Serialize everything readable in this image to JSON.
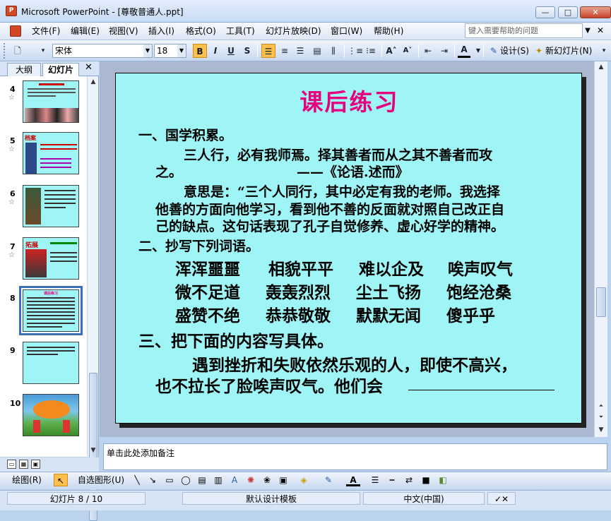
{
  "window": {
    "title": "Microsoft PowerPoint - [尊敬普通人.ppt]",
    "app_icon": "P"
  },
  "window_controls": {
    "min": "—",
    "max": "□",
    "close": "✕"
  },
  "menu": [
    "文件(F)",
    "编辑(E)",
    "视图(V)",
    "插入(I)",
    "格式(O)",
    "工具(T)",
    "幻灯片放映(D)",
    "窗口(W)",
    "帮助(H)"
  ],
  "help_placeholder": "键入需要帮助的问题",
  "toolbar": {
    "font": "宋体",
    "size": "18",
    "bold": "B",
    "italic": "I",
    "underline": "U",
    "shadow": "S",
    "font_color": "A",
    "design": "设计(S)",
    "new_slide": "新幻灯片(N)"
  },
  "pane_tabs": {
    "outline": "大纲",
    "slides": "幻灯片"
  },
  "thumbnails": [
    {
      "num": "4",
      "star": "☆"
    },
    {
      "num": "5",
      "star": "☆",
      "title": "档案"
    },
    {
      "num": "6",
      "star": "☆"
    },
    {
      "num": "7",
      "star": "☆",
      "title": "拓展"
    },
    {
      "num": "8",
      "title": "课后练习"
    },
    {
      "num": "9"
    },
    {
      "num": "10"
    }
  ],
  "slide": {
    "title": "课后练习",
    "lines": [
      "一、国学积累。",
      "三人行，必有我师焉。择其善者而从之其不善者而攻",
      "之。",
      "——《论语.述而》",
      "意思是：“三个人同行，其中必定有我的老师。我选择",
      "他善的方面向他学习，看到他不善的反面就对照自己改正自",
      "己的缺点。这句话表现了孔子自觉修养、虚心好学的精神。",
      "二、抄写下列词语。",
      "三、把下面的内容写具体。",
      "遇到挫折和失败依然乐观的人，即使不高兴，",
      "也不拉长了脸唉声叹气。他们会"
    ],
    "words": [
      [
        "浑浑噩噩",
        "相貌平平",
        "难以企及",
        "唉声叹气"
      ],
      [
        "微不足道",
        "轰轰烈烈",
        "尘土飞扬",
        "饱经沧桑"
      ],
      [
        "盛赞不绝",
        "恭恭敬敬",
        "默默无闻",
        "傻乎乎"
      ]
    ],
    "title_color": "#e6007e",
    "background": "#9ff5f5"
  },
  "notes_placeholder": "单击此处添加备注",
  "drawing": {
    "draw": "绘图(R)",
    "autoshapes": "自选图形(U)"
  },
  "status": {
    "slide": "幻灯片 8 / 10",
    "template": "默认设计模板",
    "language": "中文(中国)"
  }
}
